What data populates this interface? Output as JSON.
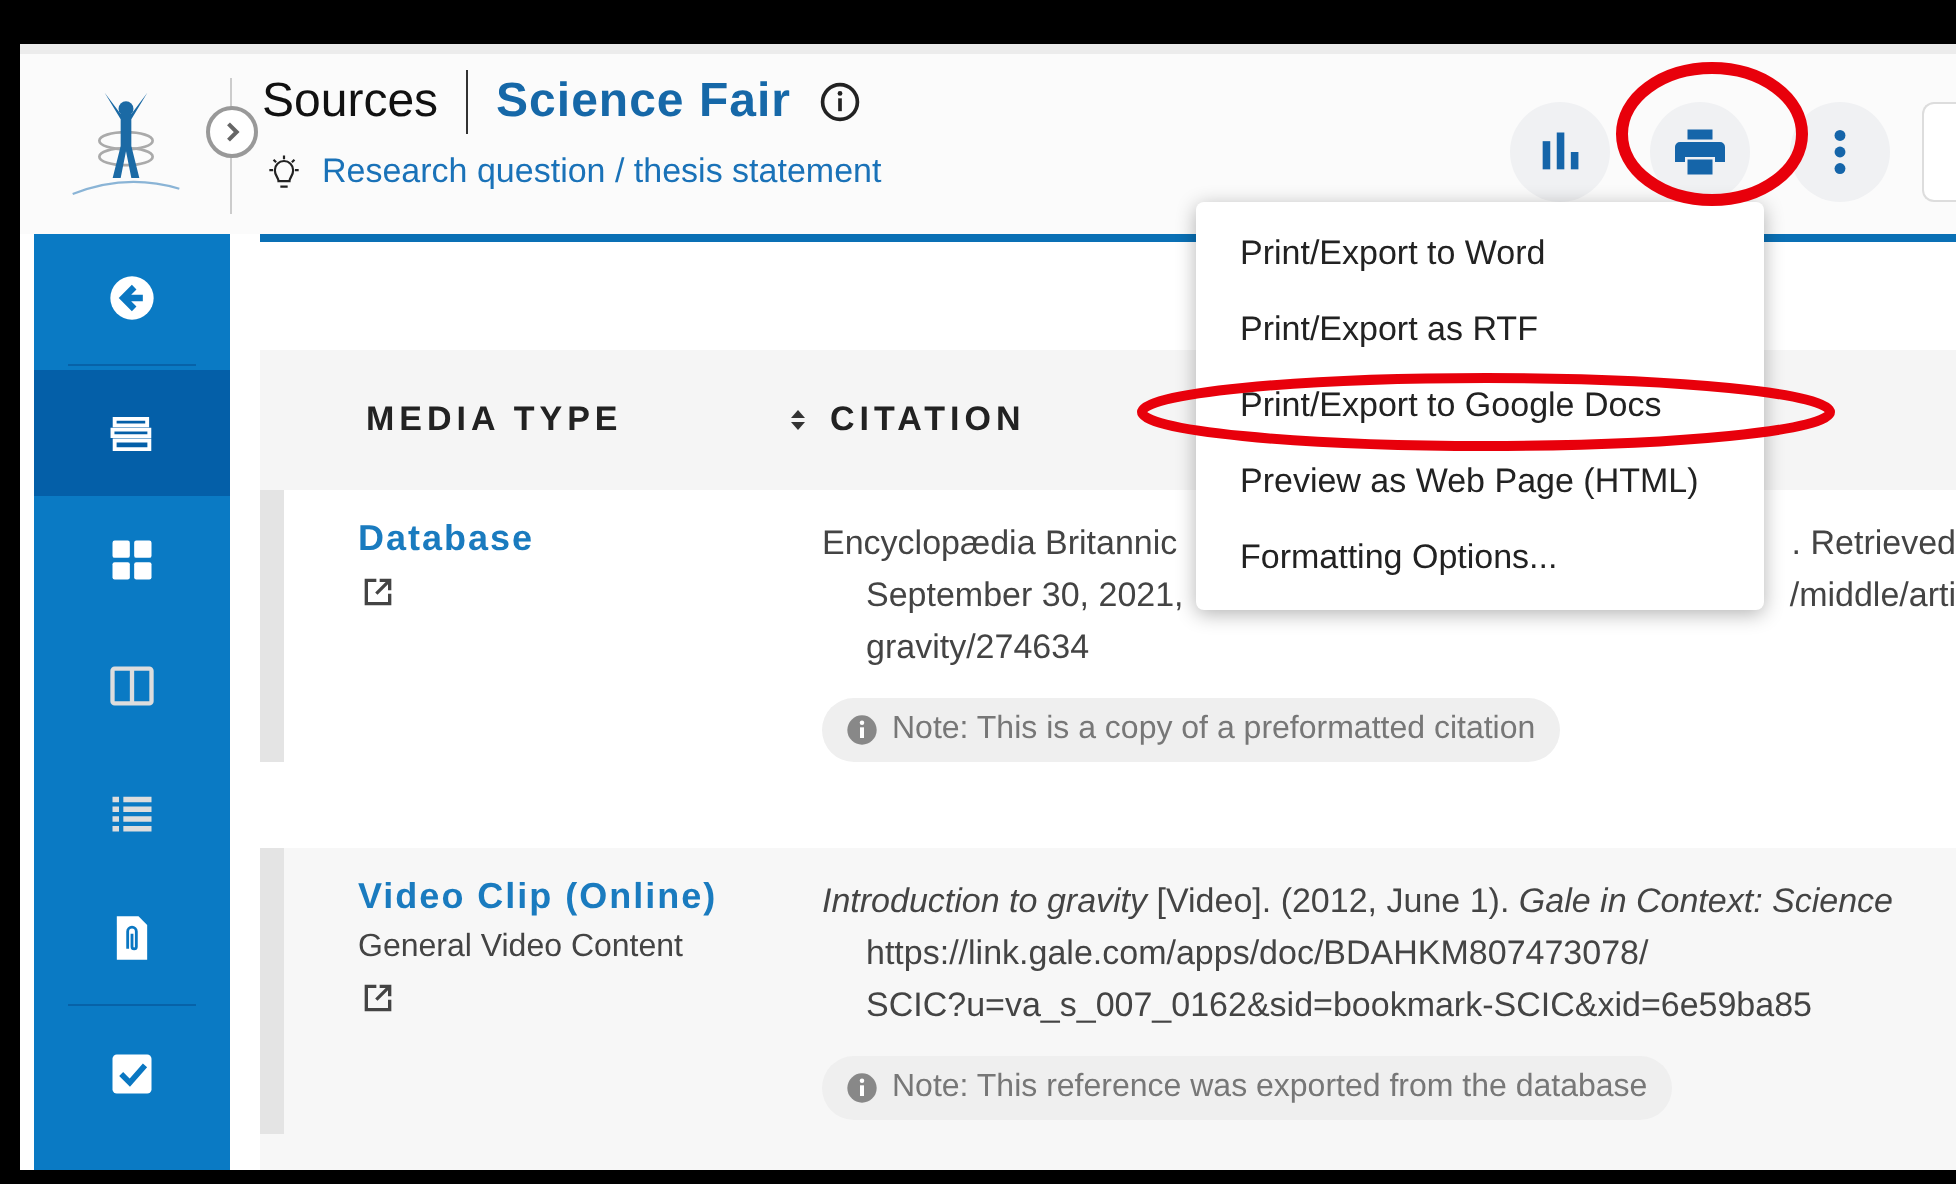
{
  "header": {
    "section": "Sources",
    "project": "Science Fair",
    "prompt": "Research question / thesis statement"
  },
  "sidebar": {
    "items": [
      {
        "kind": "back",
        "selected": false
      },
      {
        "kind": "sources",
        "selected": true
      },
      {
        "kind": "grid",
        "selected": false
      },
      {
        "kind": "columns",
        "selected": false
      },
      {
        "kind": "list",
        "selected": false
      },
      {
        "kind": "attachment",
        "selected": false
      },
      {
        "kind": "tasks",
        "selected": false
      }
    ]
  },
  "export_menu": {
    "items": [
      "Print/Export to Word",
      "Print/Export as RTF",
      "Print/Export to Google Docs",
      "Preview as Web Page (HTML)",
      "Formatting Options..."
    ]
  },
  "table": {
    "columns": [
      "MEDIA TYPE",
      "CITATION"
    ],
    "rows": [
      {
        "media_type": "Database",
        "citation_lines": [
          {
            "left": "Encyclopædia Britannic",
            "right": ". Retrieved"
          },
          {
            "left": "September 30, 2021,",
            "right": "/middle/arti"
          },
          {
            "left": "gravity/274634"
          }
        ],
        "note": "Note: This is a copy of a preformatted citation"
      },
      {
        "media_type": "Video Clip (Online)",
        "subtype": "General Video Content",
        "citation_lines": [
          {
            "left": "*Introduction to gravity* [Video]. (2012, June 1). *Gale in Context: Science*"
          },
          {
            "left": "https://link.gale.com/apps/doc/BDAHKM807473078/"
          },
          {
            "left": "SCIC?u=va_s_007_0162&sid=bookmark-SCIC&xid=6e59ba85"
          }
        ],
        "note": "Note: This reference was exported from the database"
      }
    ]
  }
}
